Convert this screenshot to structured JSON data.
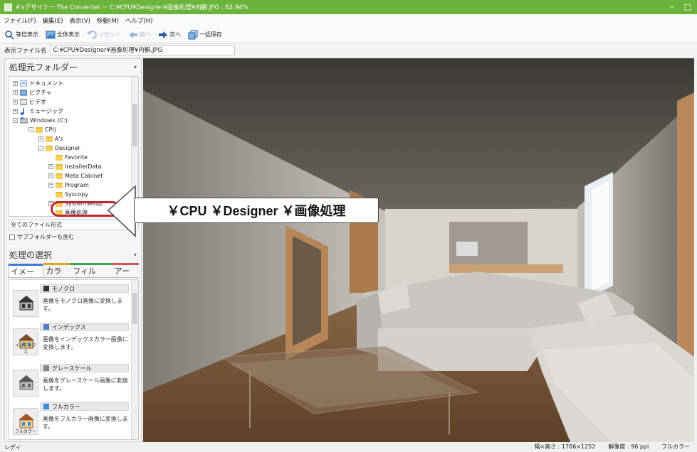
{
  "window": {
    "title": "A'sデザイナー The Converter － C:¥CPU¥Designer¥画像処理¥内観.JPG ; 62.94%"
  },
  "menu": [
    "ファイル(F)",
    "編集(E)",
    "表示(V)",
    "移動(M)",
    "ヘルプ(H)"
  ],
  "toolbar": {
    "actual_size": "等倍表示",
    "fit": "全体表示",
    "reset": "リセット",
    "prev": "前へ",
    "next": "次へ",
    "batch_save": "一括保存"
  },
  "filebar": {
    "label": "表示ファイル名",
    "path": "C:¥CPU¥Designer¥画像処理¥内観.JPG"
  },
  "source_folder": {
    "title": "処理元フォルダー",
    "tree": [
      {
        "label": "ドキュメント",
        "level": 1,
        "icon": "documents-icon"
      },
      {
        "label": "ピクチャ",
        "level": 1,
        "icon": "pictures-icon"
      },
      {
        "label": "ビデオ",
        "level": 1,
        "icon": "videos-icon"
      },
      {
        "label": "ミュージック",
        "level": 1,
        "icon": "music-icon"
      },
      {
        "label": "Windows (C:)",
        "level": 1,
        "icon": "drive-icon"
      },
      {
        "label": "CPU",
        "level": 2,
        "icon": "folder-icon"
      },
      {
        "label": "A's",
        "level": 3,
        "icon": "folder-icon"
      },
      {
        "label": "Designer",
        "level": 3,
        "icon": "folder-icon"
      },
      {
        "label": "Favorite",
        "level": 4,
        "icon": "folder-icon"
      },
      {
        "label": "InstallerData",
        "level": 4,
        "icon": "folder-icon"
      },
      {
        "label": "Meta Cabinet",
        "level": 4,
        "icon": "folder-icon"
      },
      {
        "label": "Program",
        "level": 4,
        "icon": "folder-icon"
      },
      {
        "label": "Syscopy",
        "level": 4,
        "icon": "folder-icon"
      },
      {
        "label": "SystemSetup",
        "level": 4,
        "icon": "folder-icon"
      },
      {
        "label": "画像処理",
        "level": 4,
        "icon": "folder-icon"
      }
    ],
    "file_type": "全てのファイル形式",
    "include_subfolders": "サブフォルダーも含む"
  },
  "processing": {
    "title": "処理の選択",
    "tabs": [
      {
        "label": "イメージ",
        "color": "#3a7bd5"
      },
      {
        "label": "カラー",
        "color": "#e2a21b"
      },
      {
        "label": "フィルタ...",
        "color": "#2eaa4a"
      },
      {
        "label": "アート",
        "color": "#d9534f"
      }
    ],
    "items": [
      {
        "name": "モノクロ",
        "desc": "画像をモノクロ画像に変換します。",
        "thumb_label": "",
        "swatch": "#333333"
      },
      {
        "name": "インデックス",
        "desc": "画像をインデックスカラー画像に変換します。",
        "thumb_label": "インデックス",
        "swatch": "#4a7fc1"
      },
      {
        "name": "グレースケール",
        "desc": "画像をグレースケール画像に変換します。",
        "thumb_label": "",
        "swatch": "#888888"
      },
      {
        "name": "フルカラー",
        "desc": "画像をフルカラー画像に変換します。",
        "thumb_label": "フルカラー",
        "swatch": "#3b8be0"
      }
    ]
  },
  "callout": {
    "text": "￥CPU ￥Designer ￥画像処理"
  },
  "status": {
    "left": "レディ",
    "size": "幅×高さ : 1766×1252",
    "dpi": "解像度 : 96 ppi",
    "mode": "フルカラー"
  },
  "colors": {
    "titlebar": "#6cb33b",
    "highlight_ring": "#c0282e"
  }
}
